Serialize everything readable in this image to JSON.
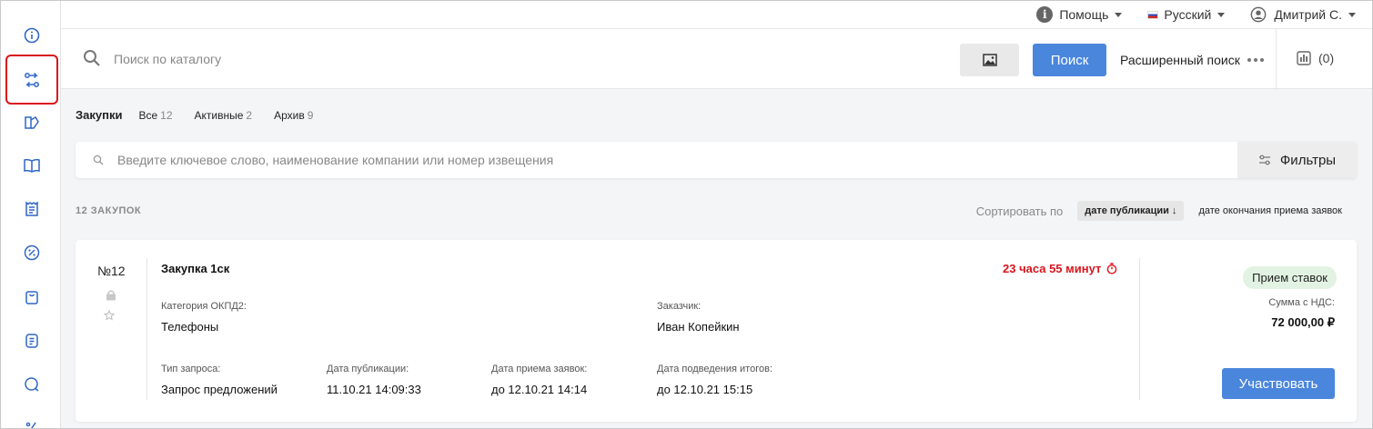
{
  "topbar": {
    "help_label": "Помощь",
    "language_label": "Русский",
    "user_label": "Дмитрий С."
  },
  "search": {
    "placeholder": "Поиск по каталогу",
    "search_button": "Поиск",
    "advanced_label": "Расширенный поиск",
    "compare_count": "(0)"
  },
  "sidebar": {
    "items": [
      {
        "icon": "info-icon"
      },
      {
        "icon": "procurement-icon",
        "active": true
      },
      {
        "icon": "catalog-icon"
      },
      {
        "icon": "book-icon"
      },
      {
        "icon": "invoice-icon"
      },
      {
        "icon": "discount-icon"
      },
      {
        "icon": "bag-icon"
      },
      {
        "icon": "document-icon"
      },
      {
        "icon": "chat-icon"
      },
      {
        "icon": "percent-icon"
      }
    ]
  },
  "tabs": {
    "title": "Закупки",
    "items": [
      {
        "label": "Все",
        "count": "12"
      },
      {
        "label": "Активные",
        "count": "2"
      },
      {
        "label": "Архив",
        "count": "9"
      }
    ]
  },
  "filter": {
    "placeholder": "Введите ключевое слово, наименование компании или номер извещения",
    "filters_button": "Фильтры"
  },
  "list": {
    "count_label": "12 ЗАКУПОК",
    "sort_label": "Сортировать по",
    "sort_active": "дате публикации ↓",
    "sort_other": "дате окончания приема заявок"
  },
  "card": {
    "number": "№12",
    "title": "Закупка 1ск",
    "timer": "23 часа 55 минут",
    "category_label": "Категория ОКПД2:",
    "category_value": "Телефоны",
    "customer_label": "Заказчик:",
    "customer_value": "Иван Копейкин",
    "request_type_label": "Тип запроса:",
    "request_type_value": "Запрос предложений",
    "pub_date_label": "Дата публикации:",
    "pub_date_value": "11.10.21 14:09:33",
    "accept_date_label": "Дата приема заявок:",
    "accept_date_value": "до 12.10.21 14:14",
    "results_date_label": "Дата подведения итогов:",
    "results_date_value": "до 12.10.21 15:15",
    "status": "Прием ставок",
    "sum_label": "Сумма с НДС:",
    "sum_value": "72 000,00 ₽",
    "participate_button": "Участвовать"
  },
  "colors": {
    "accent": "#4a86dc",
    "danger": "#d9141c",
    "status_bg": "#e3f3e3"
  }
}
